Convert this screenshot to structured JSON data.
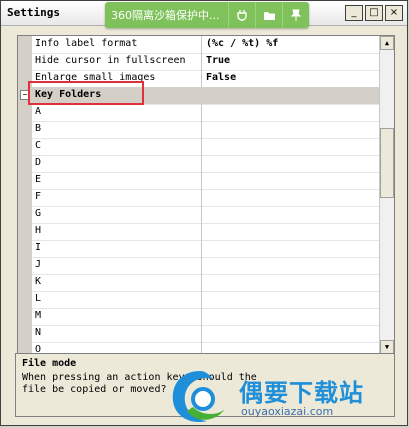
{
  "window": {
    "title": "Settings"
  },
  "overlay": {
    "text": "360隔离沙箱保护中...",
    "icons": [
      "plug-icon",
      "folder-icon",
      "pin-icon"
    ]
  },
  "window_buttons": {
    "minimize": "_",
    "maximize": "□",
    "close": "×"
  },
  "properties": [
    {
      "name": "Info label format",
      "value": "(%c / %t) %f"
    },
    {
      "name": "Hide cursor in fullscreen",
      "value": "True"
    },
    {
      "name": "Enlarge small images",
      "value": "False"
    }
  ],
  "category": {
    "label": "Key Folders",
    "expander": "−"
  },
  "key_folders": [
    "A",
    "B",
    "C",
    "D",
    "E",
    "F",
    "G",
    "H",
    "I",
    "J",
    "K",
    "L",
    "M",
    "N",
    "O"
  ],
  "description": {
    "title": "File mode",
    "text": "When pressing an action key, should the file be copied or moved?"
  },
  "watermark": {
    "brand": "偶要下载站",
    "url": "ouyaoxiazai.com"
  },
  "colors": {
    "overlay_green": "#7fc15a",
    "highlight_red": "#e0303b",
    "watermark_blue": "#1e8fd8"
  }
}
